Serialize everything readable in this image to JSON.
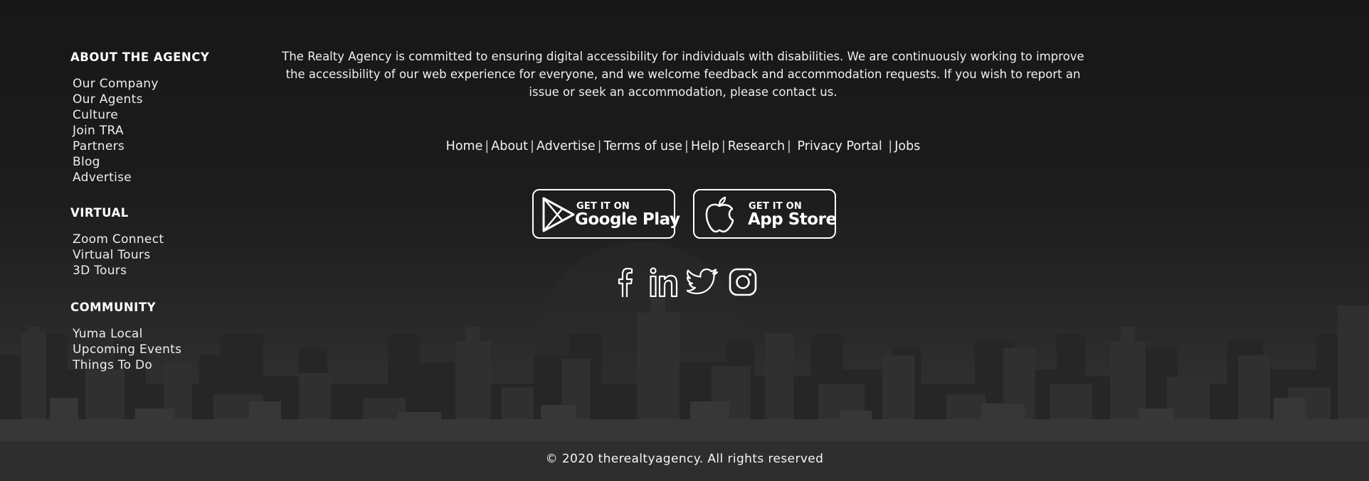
{
  "about_section": {
    "title": "ABOUT THE AGENCY",
    "links": [
      "Our Company",
      "Our Agents",
      "Culture",
      "Join TRA",
      "Partners",
      "Blog",
      "Advertise"
    ]
  },
  "virtual_section": {
    "title": "VIRTUAL",
    "links": [
      "Zoom Connect",
      "Virtual Tours",
      "3D Tours"
    ]
  },
  "community_section": {
    "title": "COMMUNITY",
    "links": [
      "Yuma Local",
      "Upcoming Events",
      "Things To Do"
    ]
  },
  "accessibility_text": "The Realty Agency is committed to ensuring digital accessibility for individuals with disabilities. We are continuously working to improve the accessibility of our web experience for everyone, and we welcome feedback and accommodation requests. If you wish to report an issue or seek an accommodation, please contact us.",
  "nav_links": [
    "Home",
    "About",
    "Advertise",
    "Terms of use",
    "Help",
    "Research",
    "Privacy Portal",
    "Jobs"
  ],
  "nav_separator": "|",
  "app_badges": {
    "google_play": {
      "small": "GET IT ON",
      "big": "Google Play",
      "icon": "google-play-icon"
    },
    "app_store": {
      "small": "GET IT ON",
      "big": "App Store",
      "icon": "apple-icon"
    }
  },
  "social_icons": [
    "facebook-icon",
    "linkedin-icon",
    "twitter-icon",
    "instagram-icon"
  ],
  "copyright": "© 2020 therealtyagency. All rights reserved",
  "colors": {
    "background": "#1a1a1a",
    "text": "#ffffff",
    "skyline": "#3a3a3a"
  }
}
